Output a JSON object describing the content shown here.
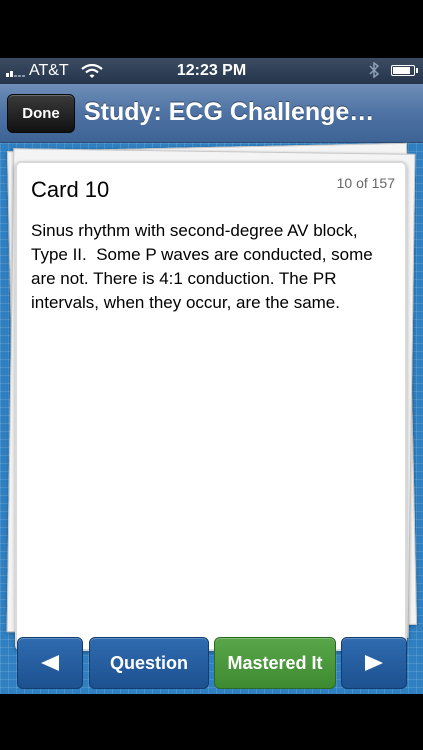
{
  "status_bar": {
    "carrier": "AT&T",
    "time": "12:23 PM",
    "icons": [
      "signal-icon",
      "wifi-icon",
      "bluetooth-icon",
      "battery-icon"
    ]
  },
  "nav": {
    "done_label": "Done",
    "title": "Study: ECG Challenge…"
  },
  "card": {
    "title": "Card 10",
    "counter": "10 of 157",
    "body": "Sinus rhythm with second-degree AV block, Type II.  Some P waves are conducted, some are not. There is 4:1 conduction. The PR intervals, when they occur, are the same."
  },
  "toolbar": {
    "prev_icon": "left-arrow-icon",
    "question_label": "Question",
    "mastered_label": "Mastered It",
    "next_icon": "right-arrow-icon"
  },
  "colors": {
    "nav_blue": "#4d72a3",
    "background_blue": "#2f7fc1",
    "button_blue": "#1d5190",
    "mastered_green": "#4a9a3c"
  }
}
